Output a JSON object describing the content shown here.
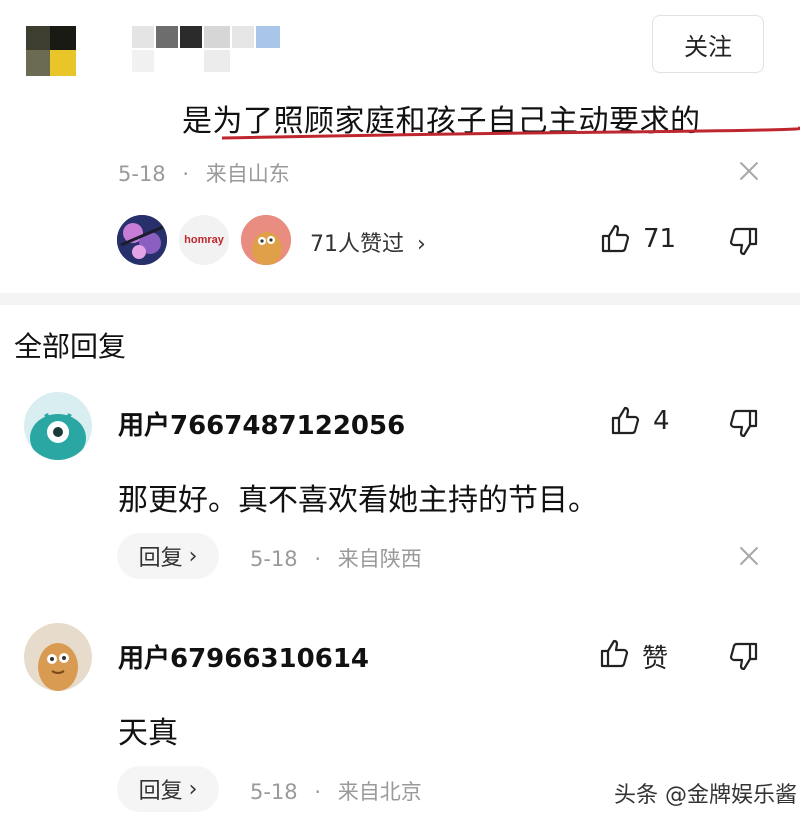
{
  "header": {
    "follow_label": "关注"
  },
  "main_comment": {
    "text": "是为了照顾家庭和孩子自己主动要求的",
    "date": "5-18",
    "separator": "·",
    "location": "来自山东",
    "avatar_brand": "homray",
    "likes_summary": "71人赞过",
    "like_count": "71",
    "underline_color": "#c0262d"
  },
  "replies_section": {
    "title": "全部回复"
  },
  "replies": [
    {
      "username": "用户7667487122056",
      "text": "那更好。真不喜欢看她主持的节目。",
      "like_label": "4",
      "reply_label": "回复",
      "date": "5-18",
      "separator": "·",
      "location": "来自陕西"
    },
    {
      "username": "用户67966310614",
      "text": "天真",
      "like_label": "赞",
      "reply_label": "回复",
      "date": "5-18",
      "separator": "·",
      "location": "来自北京"
    }
  ],
  "watermark": {
    "text": "头条 @金牌娱乐酱"
  },
  "colors": {
    "accent_underline": "#c0262d",
    "meta_gray": "#9a9a9a",
    "avatar_teal": "#2aa7a3"
  }
}
